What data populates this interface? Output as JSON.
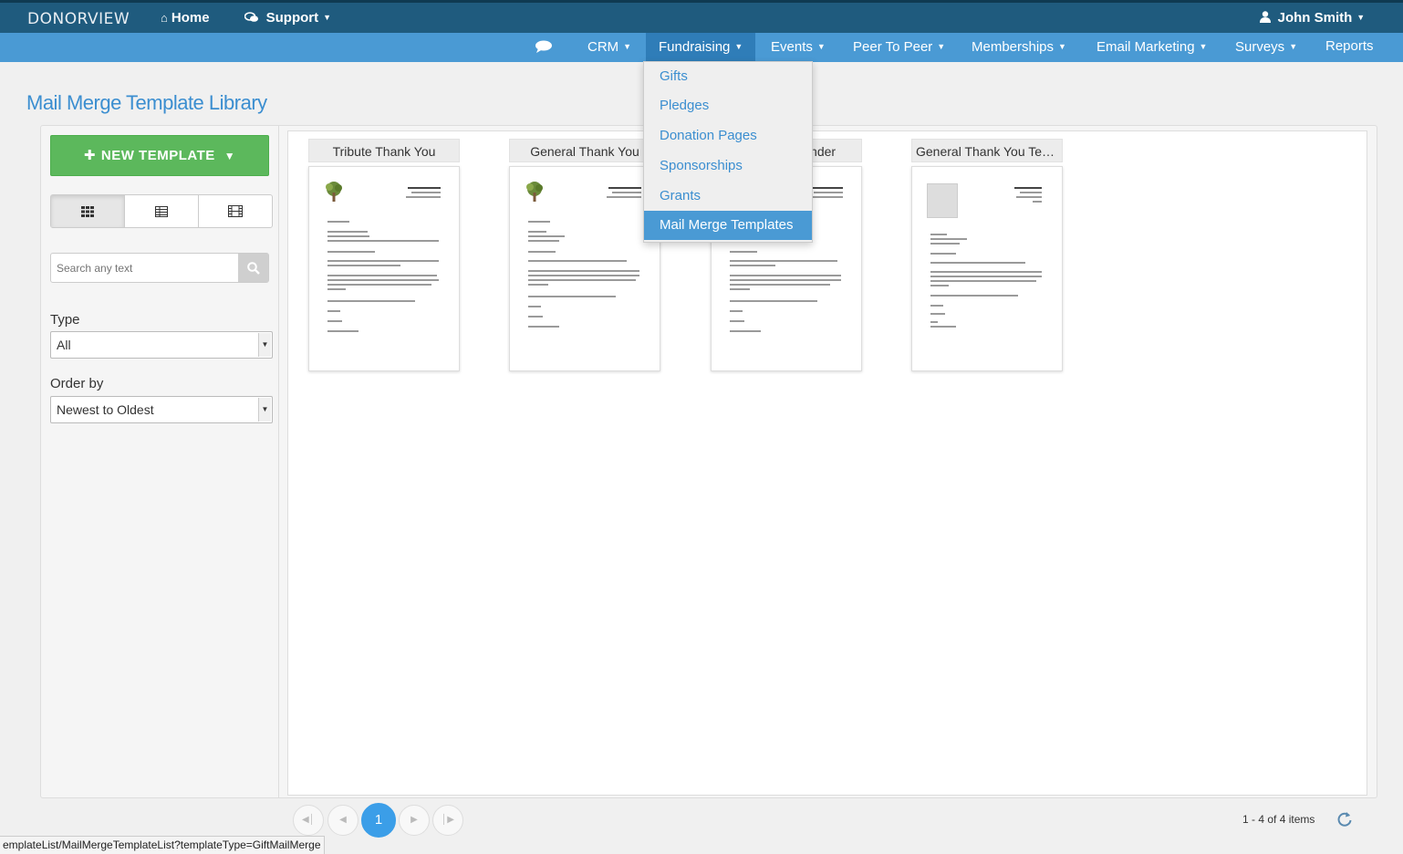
{
  "app": {
    "brand": "DONORVIEW"
  },
  "topnav": {
    "home": "Home",
    "support": "Support",
    "user": "John Smith"
  },
  "subnav": {
    "items": [
      "CRM",
      "Fundraising",
      "Events",
      "Peer To Peer",
      "Memberships",
      "Email Marketing",
      "Surveys",
      "Reports"
    ],
    "active": "Fundraising"
  },
  "dropdown": {
    "items": [
      "Gifts",
      "Pledges",
      "Donation Pages",
      "Sponsorships",
      "Grants",
      "Mail Merge Templates"
    ],
    "active": "Mail Merge Templates"
  },
  "page": {
    "title": "Mail Merge Template Library"
  },
  "sidebar": {
    "new_template": "NEW TEMPLATE",
    "search_placeholder": "Search any text",
    "type_label": "Type",
    "type_value": "All",
    "order_label": "Order by",
    "order_value": "Newest to Oldest"
  },
  "templates": [
    {
      "title": "Tribute Thank You"
    },
    {
      "title": "General Thank You"
    },
    {
      "title": "Pledge Reminder"
    },
    {
      "title": "General Thank You Template"
    }
  ],
  "pager": {
    "current": "1",
    "info": "1 - 4 of 4 items"
  },
  "status_url": "emplateList/MailMergeTemplateList?templateType=GiftMailMerge",
  "colors": {
    "topbar": "#1f5b7e",
    "subbar": "#4a9ad4",
    "accent": "#3b8ed0",
    "success": "#5cb85c"
  }
}
